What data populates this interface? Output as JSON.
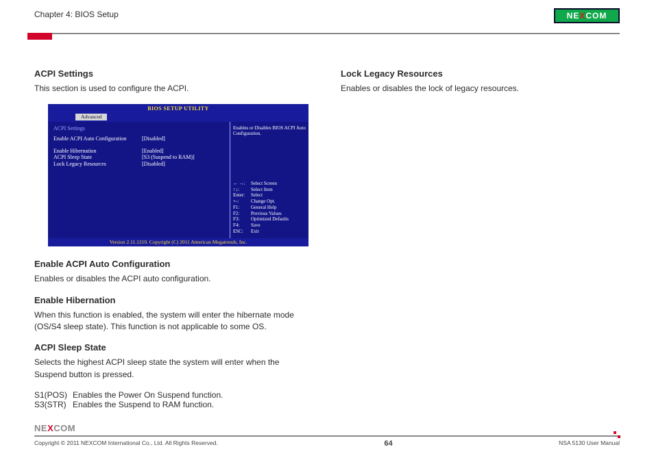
{
  "header": {
    "chapter": "Chapter 4: BIOS Setup",
    "brand": "NEXCOM"
  },
  "left_col": {
    "s1_title": "ACPI Settings",
    "s1_body": "This section is used to configure the ACPI.",
    "bios": {
      "title": "BIOS SETUP UTILITY",
      "active_tab": "Advanced",
      "section_header": "ACPI Settings",
      "rows": [
        {
          "label": "Enable ACPI Auto Configuration",
          "value": "[Disabled]"
        },
        {
          "label": "",
          "value": ""
        },
        {
          "label": "Enable Hibernation",
          "value": "[Enabled]"
        },
        {
          "label": "ACPI Sleep State",
          "value": "[S3 (Suspend to RAM)]"
        },
        {
          "label": "Lock Legacy Resources",
          "value": "[Disabled]"
        }
      ],
      "help_top": "Enables or Disables BIOS ACPI Auto Configuration.",
      "keys": [
        {
          "k": "← →:",
          "d": "Select Screen"
        },
        {
          "k": "↑↓:",
          "d": "Select Item"
        },
        {
          "k": "Enter:",
          "d": "Select"
        },
        {
          "k": "+-:",
          "d": "Change Opt."
        },
        {
          "k": "F1:",
          "d": "General Help"
        },
        {
          "k": "F2:",
          "d": "Previous Values"
        },
        {
          "k": "F3:",
          "d": "Optimized Defaults"
        },
        {
          "k": "F4:",
          "d": "Save"
        },
        {
          "k": "ESC:",
          "d": "Exit"
        }
      ],
      "footer": "Version 2.11.1210. Copyright (C) 2011 American Megatrends, Inc."
    },
    "s2_title": "Enable ACPI Auto Configuration",
    "s2_body": "Enables or disables the ACPI auto configuration.",
    "s3_title": "Enable Hibernation",
    "s3_body": "When this function is enabled, the system will enter the hibernate mode (OS/S4 sleep state). This function is not applicable to some OS.",
    "s4_title": "ACPI Sleep State",
    "s4_body": "Selects the highest ACPI sleep state the system will enter when the Suspend button is pressed.",
    "modes": [
      {
        "k": "S1(POS)",
        "d": "Enables the Power On Suspend function."
      },
      {
        "k": "S3(STR)",
        "d": "Enables the Suspend to RAM function."
      }
    ]
  },
  "right_col": {
    "s1_title": "Lock Legacy Resources",
    "s1_body": "Enables or disables the lock of legacy resources."
  },
  "footer": {
    "brand": "NEXCOM",
    "copyright": "Copyright © 2011 NEXCOM International Co., Ltd. All Rights Reserved.",
    "page": "64",
    "manual": "NSA 5130 User Manual"
  }
}
